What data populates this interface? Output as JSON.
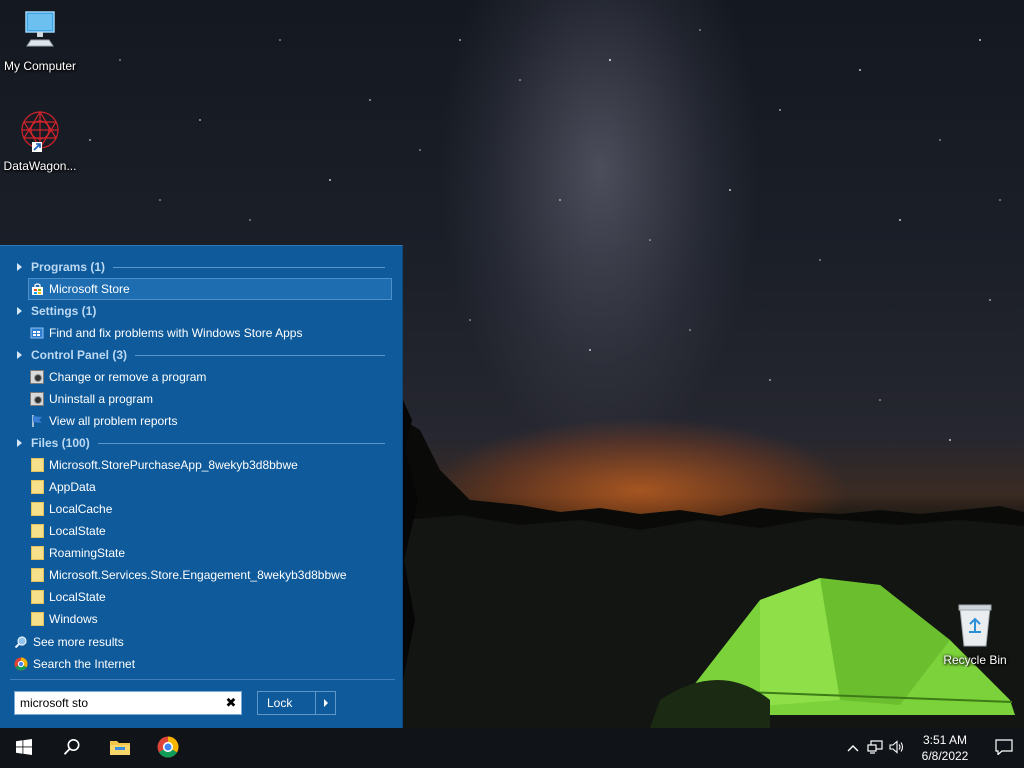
{
  "desktop": {
    "icons": [
      {
        "label": "My Computer",
        "icon": "computer-icon"
      },
      {
        "label": "DataWagon...",
        "icon": "datawagon-icon"
      },
      {
        "label": "Recycle Bin",
        "icon": "recycle-bin-icon"
      }
    ]
  },
  "start_menu": {
    "groups": [
      {
        "header": "Programs (1)",
        "items": [
          {
            "label": "Microsoft Store",
            "icon": "store-icon",
            "selected": true
          }
        ]
      },
      {
        "header": "Settings (1)",
        "items": [
          {
            "label": "Find and fix problems with Windows Store Apps",
            "icon": "troubleshoot-icon"
          }
        ]
      },
      {
        "header": "Control Panel (3)",
        "items": [
          {
            "label": "Change or remove a program",
            "icon": "control-panel-icon"
          },
          {
            "label": "Uninstall a program",
            "icon": "control-panel-icon"
          },
          {
            "label": "View all problem reports",
            "icon": "flag-icon"
          }
        ]
      },
      {
        "header": "Files (100)",
        "items": [
          {
            "label": "Microsoft.StorePurchaseApp_8wekyb3d8bbwe",
            "icon": "folder-icon"
          },
          {
            "label": "AppData",
            "icon": "folder-icon"
          },
          {
            "label": "LocalCache",
            "icon": "folder-icon"
          },
          {
            "label": "LocalState",
            "icon": "folder-icon"
          },
          {
            "label": "RoamingState",
            "icon": "folder-icon"
          },
          {
            "label": "Microsoft.Services.Store.Engagement_8wekyb3d8bbwe",
            "icon": "folder-icon"
          },
          {
            "label": "LocalState",
            "icon": "folder-icon"
          },
          {
            "label": "Windows",
            "icon": "folder-icon"
          }
        ]
      }
    ],
    "see_more": "See more results",
    "search_internet": "Search the Internet",
    "search": {
      "value": "microsoft sto"
    },
    "lock_label": "Lock"
  },
  "taskbar": {
    "pinned": [
      "windows-start-icon",
      "search-icon",
      "file-explorer-icon",
      "chrome-icon"
    ],
    "clock": {
      "time": "3:51 AM",
      "date": "6/8/2022"
    }
  },
  "colors": {
    "start_menu_bg": "#0e5a9a",
    "group_header": "#bcd9f3",
    "selection": "#1d6db0",
    "taskbar": "#101418"
  }
}
